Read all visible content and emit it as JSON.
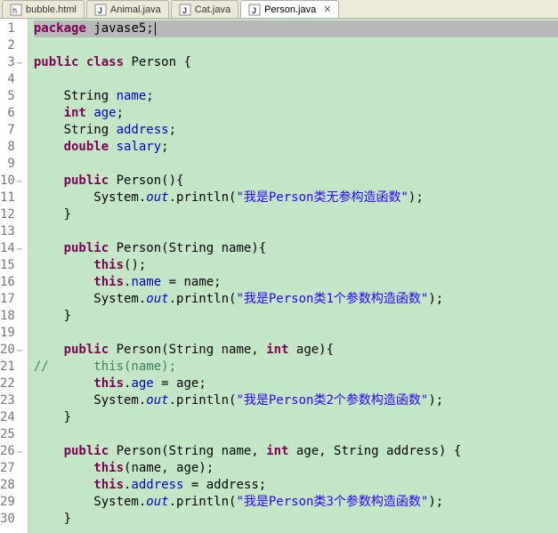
{
  "tabs": [
    {
      "label": "bubble.html",
      "type": "html",
      "active": false
    },
    {
      "label": "Animal.java",
      "type": "java",
      "active": false
    },
    {
      "label": "Cat.java",
      "type": "java",
      "active": false
    },
    {
      "label": "Person.java",
      "type": "java",
      "active": true
    }
  ],
  "close_glyph": "✕",
  "lines": [
    {
      "n": 1,
      "decor": "",
      "hl": true,
      "tokens": [
        [
          "kw",
          "package"
        ],
        [
          "",
          " javase5;"
        ]
      ]
    },
    {
      "n": 2,
      "decor": "",
      "tokens": []
    },
    {
      "n": 3,
      "decor": "−",
      "tokens": [
        [
          "kw",
          "public"
        ],
        [
          "",
          " "
        ],
        [
          "kw",
          "class"
        ],
        [
          "",
          " Person {"
        ]
      ]
    },
    {
      "n": 4,
      "decor": "",
      "tokens": []
    },
    {
      "n": 5,
      "decor": "",
      "tokens": [
        [
          "",
          "    String "
        ],
        [
          "field",
          "name"
        ],
        [
          "",
          ";"
        ]
      ]
    },
    {
      "n": 6,
      "decor": "",
      "tokens": [
        [
          "",
          "    "
        ],
        [
          "kw",
          "int"
        ],
        [
          "",
          " "
        ],
        [
          "field",
          "age"
        ],
        [
          "",
          ";"
        ]
      ]
    },
    {
      "n": 7,
      "decor": "",
      "tokens": [
        [
          "",
          "    String "
        ],
        [
          "field",
          "address"
        ],
        [
          "",
          ";"
        ]
      ]
    },
    {
      "n": 8,
      "decor": "",
      "tokens": [
        [
          "",
          "    "
        ],
        [
          "kw",
          "double"
        ],
        [
          "",
          " "
        ],
        [
          "field",
          "salary"
        ],
        [
          "",
          ";"
        ]
      ]
    },
    {
      "n": 9,
      "decor": "",
      "tokens": []
    },
    {
      "n": 10,
      "decor": "−",
      "tokens": [
        [
          "",
          "    "
        ],
        [
          "kw",
          "public"
        ],
        [
          "",
          " Person(){"
        ]
      ]
    },
    {
      "n": 11,
      "decor": "",
      "tokens": [
        [
          "",
          "        System."
        ],
        [
          "it",
          "out"
        ],
        [
          "",
          ".println("
        ],
        [
          "str",
          "\"我是Person类无参构造函数\""
        ],
        [
          "",
          ");"
        ]
      ]
    },
    {
      "n": 12,
      "decor": "",
      "tokens": [
        [
          "",
          "    }"
        ]
      ]
    },
    {
      "n": 13,
      "decor": "",
      "tokens": []
    },
    {
      "n": 14,
      "decor": "−",
      "tokens": [
        [
          "",
          "    "
        ],
        [
          "kw",
          "public"
        ],
        [
          "",
          " Person(String name){"
        ]
      ]
    },
    {
      "n": 15,
      "decor": "",
      "tokens": [
        [
          "",
          "        "
        ],
        [
          "kw",
          "this"
        ],
        [
          "",
          "();"
        ]
      ]
    },
    {
      "n": 16,
      "decor": "",
      "tokens": [
        [
          "",
          "        "
        ],
        [
          "kw",
          "this"
        ],
        [
          "",
          "."
        ],
        [
          "field",
          "name"
        ],
        [
          "",
          " = name;"
        ]
      ]
    },
    {
      "n": 17,
      "decor": "",
      "tokens": [
        [
          "",
          "        System."
        ],
        [
          "it",
          "out"
        ],
        [
          "",
          ".println("
        ],
        [
          "str",
          "\"我是Person类1个参数构造函数\""
        ],
        [
          "",
          ");"
        ]
      ]
    },
    {
      "n": 18,
      "decor": "",
      "tokens": [
        [
          "",
          "    }"
        ]
      ]
    },
    {
      "n": 19,
      "decor": "",
      "tokens": []
    },
    {
      "n": 20,
      "decor": "−",
      "tokens": [
        [
          "",
          "    "
        ],
        [
          "kw",
          "public"
        ],
        [
          "",
          " Person(String name, "
        ],
        [
          "kw",
          "int"
        ],
        [
          "",
          " age){"
        ]
      ]
    },
    {
      "n": 21,
      "decor": "",
      "tokens": [
        [
          "cmt",
          "//      this(name);"
        ]
      ]
    },
    {
      "n": 22,
      "decor": "",
      "tokens": [
        [
          "",
          "        "
        ],
        [
          "kw",
          "this"
        ],
        [
          "",
          "."
        ],
        [
          "field",
          "age"
        ],
        [
          "",
          " = age;"
        ]
      ]
    },
    {
      "n": 23,
      "decor": "",
      "tokens": [
        [
          "",
          "        System."
        ],
        [
          "it",
          "out"
        ],
        [
          "",
          ".println("
        ],
        [
          "str",
          "\"我是Person类2个参数构造函数\""
        ],
        [
          "",
          ");"
        ]
      ]
    },
    {
      "n": 24,
      "decor": "",
      "tokens": [
        [
          "",
          "    }"
        ]
      ]
    },
    {
      "n": 25,
      "decor": "",
      "tokens": []
    },
    {
      "n": 26,
      "decor": "−",
      "tokens": [
        [
          "",
          "    "
        ],
        [
          "kw",
          "public"
        ],
        [
          "",
          " Person(String name, "
        ],
        [
          "kw",
          "int"
        ],
        [
          "",
          " age, String address) {"
        ]
      ]
    },
    {
      "n": 27,
      "decor": "",
      "tokens": [
        [
          "",
          "        "
        ],
        [
          "kw",
          "this"
        ],
        [
          "",
          "(name, age);"
        ]
      ]
    },
    {
      "n": 28,
      "decor": "",
      "tokens": [
        [
          "",
          "        "
        ],
        [
          "kw",
          "this"
        ],
        [
          "",
          "."
        ],
        [
          "field",
          "address"
        ],
        [
          "",
          " = address;"
        ]
      ]
    },
    {
      "n": 29,
      "decor": "",
      "tokens": [
        [
          "",
          "        System."
        ],
        [
          "it",
          "out"
        ],
        [
          "",
          ".println("
        ],
        [
          "str",
          "\"我是Person类3个参数构造函数\""
        ],
        [
          "",
          ");"
        ]
      ]
    },
    {
      "n": 30,
      "decor": "",
      "tokens": [
        [
          "",
          "    }"
        ]
      ]
    }
  ]
}
